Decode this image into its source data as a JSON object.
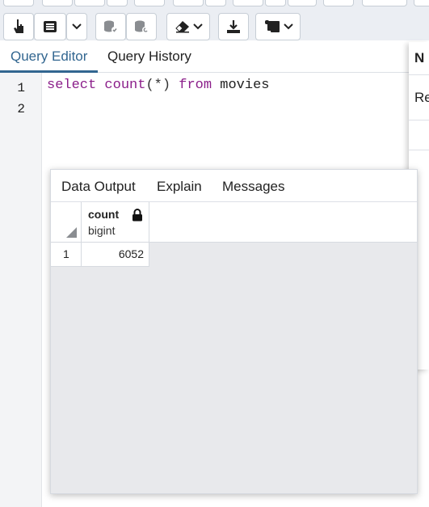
{
  "editor": {
    "tabs": [
      "Query Editor",
      "Query History"
    ],
    "line_numbers": [
      "1",
      "2"
    ],
    "code": {
      "kw_select": "select",
      "fn_count": "count",
      "args": "(*)",
      "kw_from": "from",
      "table": "movies"
    }
  },
  "side_panel": {
    "text1": "N",
    "text2": "Re"
  },
  "results": {
    "tabs": [
      "Data Output",
      "Explain",
      "Messages"
    ],
    "columns": [
      {
        "name": "count",
        "type": "bigint"
      }
    ],
    "rows": [
      {
        "num": "1",
        "values": [
          "6052"
        ]
      }
    ]
  },
  "icons": {
    "accent": "#326690",
    "keyword_color": "#8b1e8a"
  }
}
